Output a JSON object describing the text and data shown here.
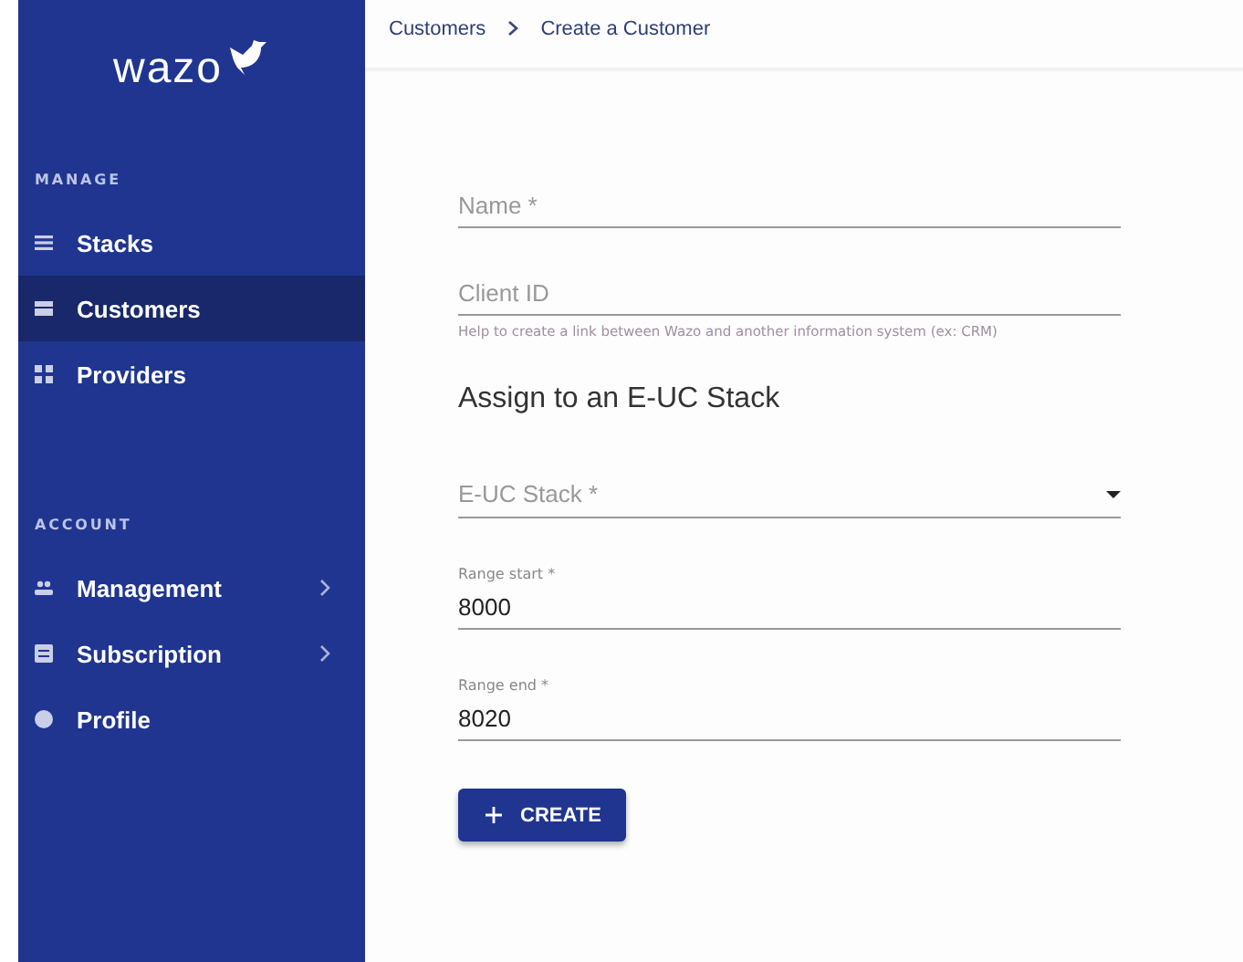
{
  "sidebar": {
    "logo": "wazo",
    "sections": [
      {
        "heading": "MANAGE",
        "items": [
          {
            "label": "Stacks",
            "kind": "list",
            "selected": false
          },
          {
            "label": "Customers",
            "kind": "store",
            "selected": true
          },
          {
            "label": "Providers",
            "kind": "grid",
            "selected": false
          }
        ]
      },
      {
        "heading": "ACCOUNT",
        "items": [
          {
            "label": "Management",
            "kind": "people",
            "selected": false,
            "expandable": true
          },
          {
            "label": "Subscription",
            "kind": "card",
            "selected": false,
            "expandable": true
          },
          {
            "label": "Profile",
            "kind": "account",
            "selected": false
          }
        ]
      }
    ]
  },
  "breadcrumb": [
    "Customers",
    "Create a Customer"
  ],
  "form": {
    "fields": [
      {
        "kind": "text",
        "placeholder": "Name *"
      },
      {
        "kind": "text",
        "placeholder": "Client ID",
        "helper": "Help to create a link between Wazo and another information system (ex: CRM)"
      },
      {
        "kind": "heading",
        "text": "Assign to an E-UC Stack"
      },
      {
        "kind": "select",
        "placeholder": "E-UC Stack *"
      },
      {
        "kind": "text",
        "label": "Range start *",
        "value": "8000"
      },
      {
        "kind": "text",
        "label": "Range end *",
        "value": "8020"
      }
    ],
    "button": "CREATE"
  }
}
